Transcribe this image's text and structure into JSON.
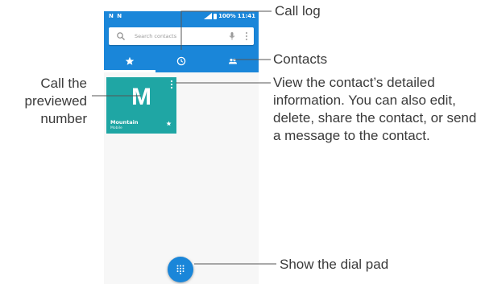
{
  "status_bar": {
    "left_icons": "N N",
    "battery": "100%",
    "time": "11:41"
  },
  "search": {
    "placeholder": "Search contacts"
  },
  "tabs": [
    {
      "name": "favorites",
      "icon": "star-icon",
      "active": true
    },
    {
      "name": "call-log",
      "icon": "clock-icon",
      "active": false
    },
    {
      "name": "contacts",
      "icon": "people-icon",
      "active": false
    }
  ],
  "contact_card": {
    "initial": "M",
    "name": "Mountain",
    "type": "Mobile",
    "color": "#1fa6a4"
  },
  "accent_color": "#1a86d9",
  "callouts": {
    "call_log": "Call log",
    "contacts": "Contacts",
    "view_contact": "View the contact’s detailed information. You can also edit, delete, share the contact, or send a message to the contact.",
    "call_previewed": "Call the previewed number",
    "dial_pad": "Show the dial pad"
  }
}
